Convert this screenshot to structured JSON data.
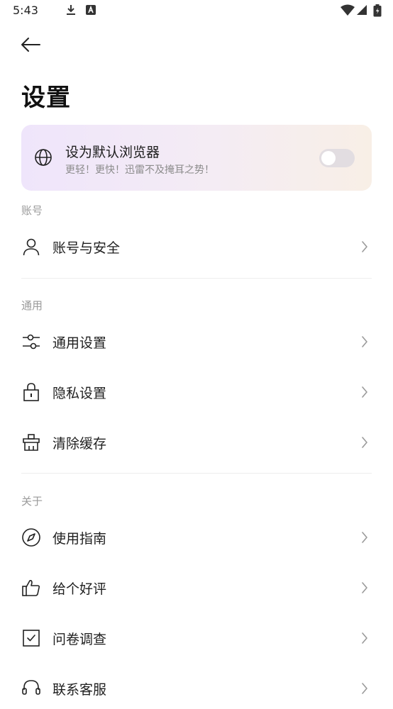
{
  "status_bar": {
    "time": "5:43",
    "icons": [
      "download-icon",
      "notification-a-icon",
      "wifi-icon",
      "signal-icon",
      "battery-icon"
    ]
  },
  "header": {
    "back_icon": "arrow-left-icon",
    "title": "设置"
  },
  "default_browser_card": {
    "icon": "globe-icon",
    "title": "设为默认浏览器",
    "subtitle": "更轻！更快！迅雷不及掩耳之势！",
    "toggle_on": false,
    "colors": {
      "gradient_start": "#efe5fb",
      "gradient_end": "#f8efe6",
      "toggle_track": "#e2dde1"
    }
  },
  "sections": [
    {
      "label": "账号",
      "items": [
        {
          "label": "账号与安全",
          "icon": "user-icon"
        }
      ]
    },
    {
      "label": "通用",
      "items": [
        {
          "label": "通用设置",
          "icon": "sliders-icon"
        },
        {
          "label": "隐私设置",
          "icon": "lock-icon"
        },
        {
          "label": "清除缓存",
          "icon": "broom-icon"
        }
      ]
    },
    {
      "label": "关于",
      "items": [
        {
          "label": "使用指南",
          "icon": "compass-icon"
        },
        {
          "label": "给个好评",
          "icon": "thumbs-up-icon"
        },
        {
          "label": "问卷调查",
          "icon": "checkbox-icon"
        },
        {
          "label": "联系客服",
          "icon": "headset-icon"
        }
      ]
    }
  ]
}
